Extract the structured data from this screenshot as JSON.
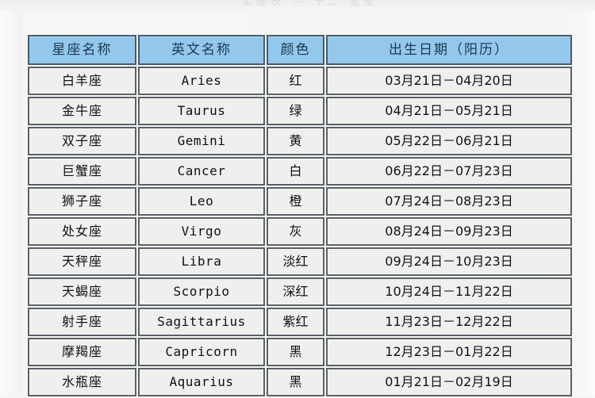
{
  "document": {
    "ghost_top_text": "星座表 — 十二 星座",
    "background_color": "#f4f5f4",
    "header_color": "#93c7ec",
    "cell_color": "#eff0ee",
    "border_color": "#5a6066"
  },
  "table": {
    "columns": [
      {
        "key": "name",
        "label": "星座名称"
      },
      {
        "key": "en",
        "label": "英文名称"
      },
      {
        "key": "color",
        "label": "颜色"
      },
      {
        "key": "date",
        "label": "出生日期（阳历）"
      }
    ],
    "rows": [
      {
        "name": "白羊座",
        "en": "Aries",
        "color": "红",
        "date": "03月21日－04月20日"
      },
      {
        "name": "金牛座",
        "en": "Taurus",
        "color": "绿",
        "date": "04月21日－05月21日"
      },
      {
        "name": "双子座",
        "en": "Gemini",
        "color": "黄",
        "date": "05月22日－06月21日"
      },
      {
        "name": "巨蟹座",
        "en": "Cancer",
        "color": "白",
        "date": "06月22日－07月23日"
      },
      {
        "name": "狮子座",
        "en": "Leo",
        "color": "橙",
        "date": "07月24日－08月23日"
      },
      {
        "name": "处女座",
        "en": "Virgo",
        "color": "灰",
        "date": "08月24日－09月23日"
      },
      {
        "name": "天秤座",
        "en": "Libra",
        "color": "淡红",
        "date": "09月24日－10月23日"
      },
      {
        "name": "天蝎座",
        "en": "Scorpio",
        "color": "深红",
        "date": "10月24日－11月22日"
      },
      {
        "name": "射手座",
        "en": "Sagittarius",
        "color": "紫红",
        "date": "11月23日－12月22日"
      },
      {
        "name": "摩羯座",
        "en": "Capricorn",
        "color": "黑",
        "date": "12月23日－01月22日"
      },
      {
        "name": "水瓶座",
        "en": "Aquarius",
        "color": "黑",
        "date": "01月21日－02月19日"
      }
    ]
  }
}
